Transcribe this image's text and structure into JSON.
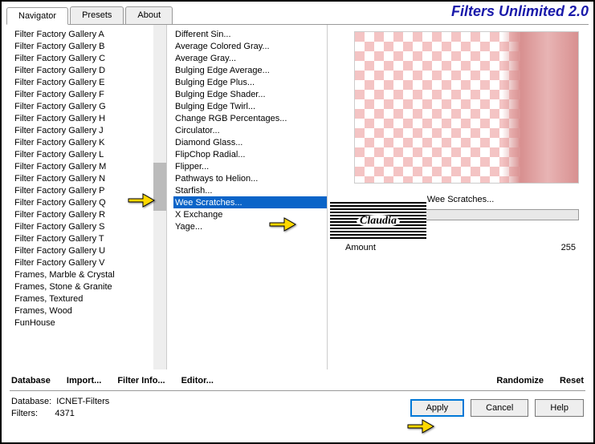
{
  "banner": "Filters Unlimited 2.0",
  "tabs": [
    "Navigator",
    "Presets",
    "About"
  ],
  "cats": [
    "Filter Factory Gallery A",
    "Filter Factory Gallery B",
    "Filter Factory Gallery C",
    "Filter Factory Gallery D",
    "Filter Factory Gallery E",
    "Filter Factory Gallery F",
    "Filter Factory Gallery G",
    "Filter Factory Gallery H",
    "Filter Factory Gallery J",
    "Filter Factory Gallery K",
    "Filter Factory Gallery L",
    "Filter Factory Gallery M",
    "Filter Factory Gallery N",
    "Filter Factory Gallery P",
    "Filter Factory Gallery Q",
    "Filter Factory Gallery R",
    "Filter Factory Gallery S",
    "Filter Factory Gallery T",
    "Filter Factory Gallery U",
    "Filter Factory Gallery V",
    "Frames, Marble & Crystal",
    "Frames, Stone & Granite",
    "Frames, Textured",
    "Frames, Wood",
    "FunHouse"
  ],
  "filters": [
    " Different Sin...",
    "Average Colored Gray...",
    "Average Gray...",
    "Bulging Edge Average...",
    "Bulging Edge Plus...",
    "Bulging Edge Shader...",
    "Bulging Edge Twirl...",
    "Change RGB Percentages...",
    "Circulator...",
    "Diamond Glass...",
    "FlipChop Radial...",
    "Flipper...",
    "Pathways to Helion...",
    "Starfish...",
    "Wee Scratches...",
    "X Exchange",
    "Yage..."
  ],
  "selected_filter": "Wee Scratches...",
  "param": {
    "label": "Amount",
    "value": "255"
  },
  "cmds": {
    "database": "Database",
    "import": "Import...",
    "info": "Filter Info...",
    "editor": "Editor...",
    "randomize": "Randomize",
    "reset": "Reset"
  },
  "meta": {
    "db_label": "Database:",
    "db": "ICNET-Filters",
    "filters_label": "Filters:",
    "filters": "4371"
  },
  "btns": {
    "apply": "Apply",
    "cancel": "Cancel",
    "help": "Help"
  },
  "logo": "Claudia"
}
